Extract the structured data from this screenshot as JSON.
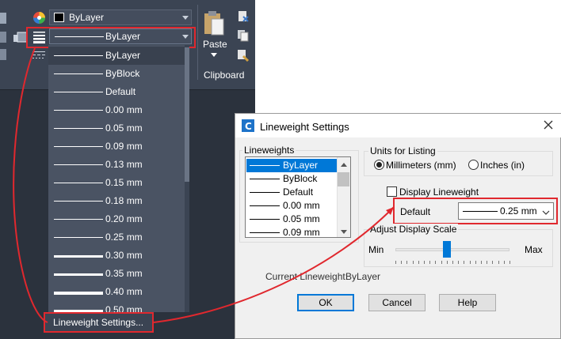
{
  "ribbon": {
    "color_select": {
      "value": "ByLayer",
      "swatch": "#000000"
    },
    "lineweight_select": {
      "value": "ByLayer"
    },
    "clipboard": {
      "paste_label": "Paste",
      "panel_label": "Clipboard"
    }
  },
  "dropdown": {
    "items": [
      {
        "label": "ByLayer",
        "weight": 1,
        "selected": true
      },
      {
        "label": "ByBlock",
        "weight": 1
      },
      {
        "label": "Default",
        "weight": 1
      },
      {
        "label": "0.00 mm",
        "weight": 1
      },
      {
        "label": "0.05 mm",
        "weight": 1
      },
      {
        "label": "0.09 mm",
        "weight": 1
      },
      {
        "label": "0.13 mm",
        "weight": 1
      },
      {
        "label": "0.15 mm",
        "weight": 1
      },
      {
        "label": "0.18 mm",
        "weight": 1
      },
      {
        "label": "0.20 mm",
        "weight": 1
      },
      {
        "label": "0.25 mm",
        "weight": 1
      },
      {
        "label": "0.30 mm",
        "weight": 3
      },
      {
        "label": "0.35 mm",
        "weight": 3
      },
      {
        "label": "0.40 mm",
        "weight": 4
      },
      {
        "label": "0.50 mm",
        "weight": 4
      }
    ],
    "settings_label": "Lineweight Settings..."
  },
  "dialog": {
    "title": "Lineweight Settings",
    "lineweights_label": "Lineweights",
    "list_items": [
      "ByLayer",
      "ByBlock",
      "Default",
      "0.00 mm",
      "0.05 mm",
      "0.09 mm"
    ],
    "units_label": "Units for Listing",
    "radio_mm": "Millimeters (mm)",
    "radio_in": "Inches (in)",
    "display_lineweight": "Display Lineweight",
    "default_label": "Default",
    "default_value": "0.25 mm",
    "scale_label": "Adjust Display Scale",
    "scale_min": "Min",
    "scale_max": "Max",
    "scale_level": 0.45,
    "current_label": "Current Lineweight:",
    "current_value": "ByLayer",
    "ok": "OK",
    "cancel": "Cancel",
    "help": "Help"
  },
  "colors": {
    "highlight": "#e0282e",
    "selection": "#0078d7"
  }
}
